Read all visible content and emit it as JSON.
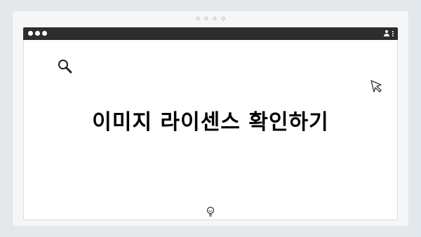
{
  "window": {
    "controls": [
      "close",
      "minimize",
      "maximize"
    ],
    "right_icons": [
      "user-icon",
      "kebab-menu-icon"
    ]
  },
  "page": {
    "title": "이미지 라이센스 확인하기",
    "icons": [
      "search-icon",
      "cursor-icon",
      "lightbulb-icon"
    ]
  },
  "colors": {
    "background": "#e3e8ec",
    "frame": "#f4f6f8",
    "browser_bar": "#2d2d2d",
    "page": "#ffffff",
    "text": "#000000"
  }
}
